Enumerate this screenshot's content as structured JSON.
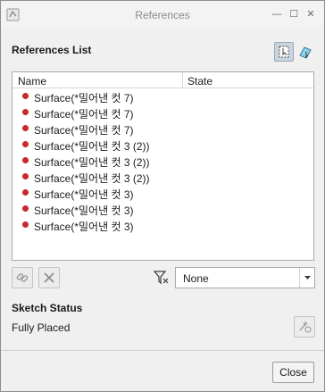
{
  "window": {
    "title": "References",
    "controls": {
      "minimize": "—",
      "maximize": "☐",
      "close": "✕"
    }
  },
  "references": {
    "section_title": "References List",
    "columns": [
      "Name",
      "State"
    ],
    "items": [
      {
        "name": "Surface(*밀어낸 컷 7)",
        "state": "",
        "status_color": "#c6292b"
      },
      {
        "name": "Surface(*밀어낸 컷 7)",
        "state": "",
        "status_color": "#c6292b"
      },
      {
        "name": "Surface(*밀어낸 컷 7)",
        "state": "",
        "status_color": "#c6292b"
      },
      {
        "name": "Surface(*밀어낸 컷 3 (2))",
        "state": "",
        "status_color": "#c6292b"
      },
      {
        "name": "Surface(*밀어낸 컷 3 (2))",
        "state": "",
        "status_color": "#c6292b"
      },
      {
        "name": "Surface(*밀어낸 컷 3 (2))",
        "state": "",
        "status_color": "#c6292b"
      },
      {
        "name": "Surface(*밀어낸 컷 3)",
        "state": "",
        "status_color": "#c6292b"
      },
      {
        "name": "Surface(*밀어낸 컷 3)",
        "state": "",
        "status_color": "#c6292b"
      },
      {
        "name": "Surface(*밀어낸 컷 3)",
        "state": "",
        "status_color": "#c6292b"
      }
    ]
  },
  "toolbar": {
    "add_icon": "chain-link-icon",
    "remove_icon": "x-icon",
    "filter_icon": "filter-icon",
    "filter_value": "None"
  },
  "sketch_status": {
    "section_title": "Sketch Status",
    "status": "Fully Placed"
  },
  "footer": {
    "close_label": "Close"
  }
}
